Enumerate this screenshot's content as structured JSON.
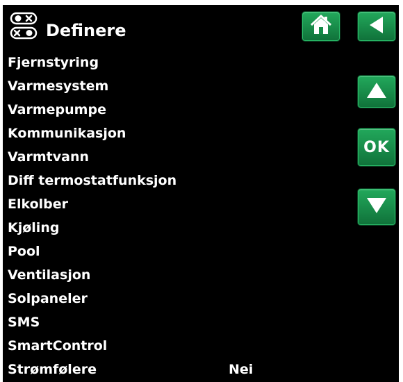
{
  "header": {
    "title": "Definere"
  },
  "menu": {
    "items": [
      {
        "label": "Fjernstyring",
        "value": ""
      },
      {
        "label": "Varmesystem",
        "value": ""
      },
      {
        "label": "Varmepumpe",
        "value": ""
      },
      {
        "label": "Kommunikasjon",
        "value": ""
      },
      {
        "label": "Varmtvann",
        "value": ""
      },
      {
        "label": "Diff termostatfunksjon",
        "value": ""
      },
      {
        "label": "Elkolber",
        "value": ""
      },
      {
        "label": "Kjøling",
        "value": ""
      },
      {
        "label": "Pool",
        "value": ""
      },
      {
        "label": "Ventilasjon",
        "value": ""
      },
      {
        "label": "Solpaneler",
        "value": ""
      },
      {
        "label": "SMS",
        "value": ""
      },
      {
        "label": "SmartControl",
        "value": ""
      },
      {
        "label": "Strømfølere",
        "value": "Nei"
      }
    ]
  },
  "buttons": {
    "ok_label": "OK"
  },
  "icons": {
    "menu": "settings-toggle-icon",
    "home": "home-icon",
    "back": "back-arrow-icon",
    "up": "up-arrow-icon",
    "down": "down-arrow-icon"
  },
  "colors": {
    "background": "#000000",
    "text": "#ffffff",
    "button": "#1a8a4a"
  }
}
